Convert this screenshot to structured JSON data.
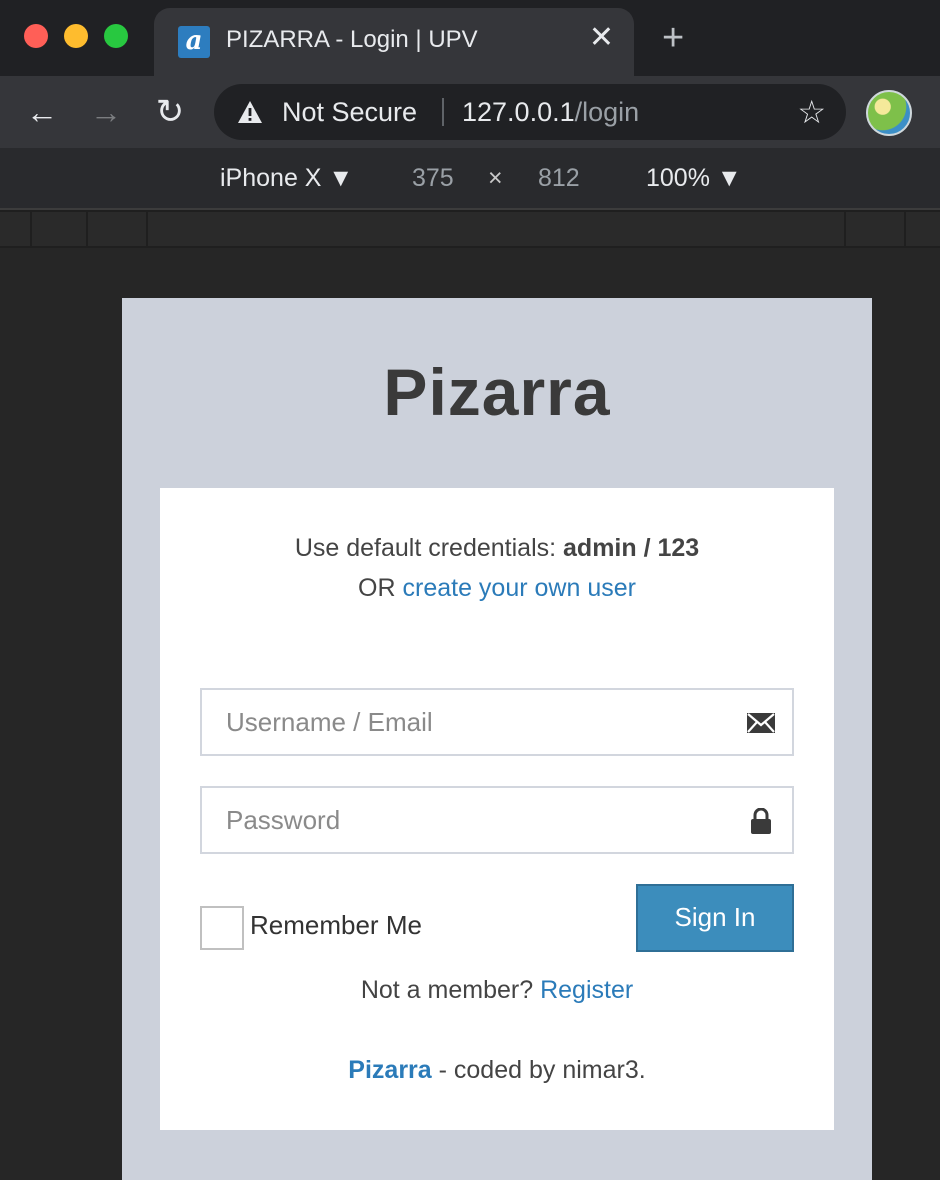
{
  "browser": {
    "tab": {
      "title": "PIZARRA - Login | UPV",
      "favicon_letter": "a",
      "close_label": "✕"
    },
    "new_tab_label": "+",
    "nav": {
      "back": "←",
      "forward": "→",
      "reload": "↻"
    },
    "security_label": "Not Secure",
    "url_host": "127.0.0.1",
    "url_path": "/login",
    "bookmark_icon": "☆"
  },
  "device_toolbar": {
    "device": "iPhone X ▼",
    "width": "375",
    "times": "×",
    "height": "812",
    "zoom": "100% ▼"
  },
  "page": {
    "brand": "Pizarra",
    "credentials_prefix": "Use default credentials: ",
    "credentials_value": "admin / 123",
    "or_text": "OR ",
    "create_user_link": "create your own user",
    "username_placeholder": "Username / Email",
    "password_placeholder": "Password",
    "remember_label": "Remember Me",
    "signin_label": "Sign In",
    "not_member_text": "Not a member? ",
    "register_link": "Register",
    "footer_brand": "Pizarra",
    "footer_text": " - coded by nimar3."
  },
  "colors": {
    "accent": "#3c8dbc",
    "link": "#2b7bb9",
    "viewport_bg": "#ccd1db"
  },
  "icons": [
    "warning-icon",
    "star-icon",
    "envelope-icon",
    "lock-icon"
  ]
}
